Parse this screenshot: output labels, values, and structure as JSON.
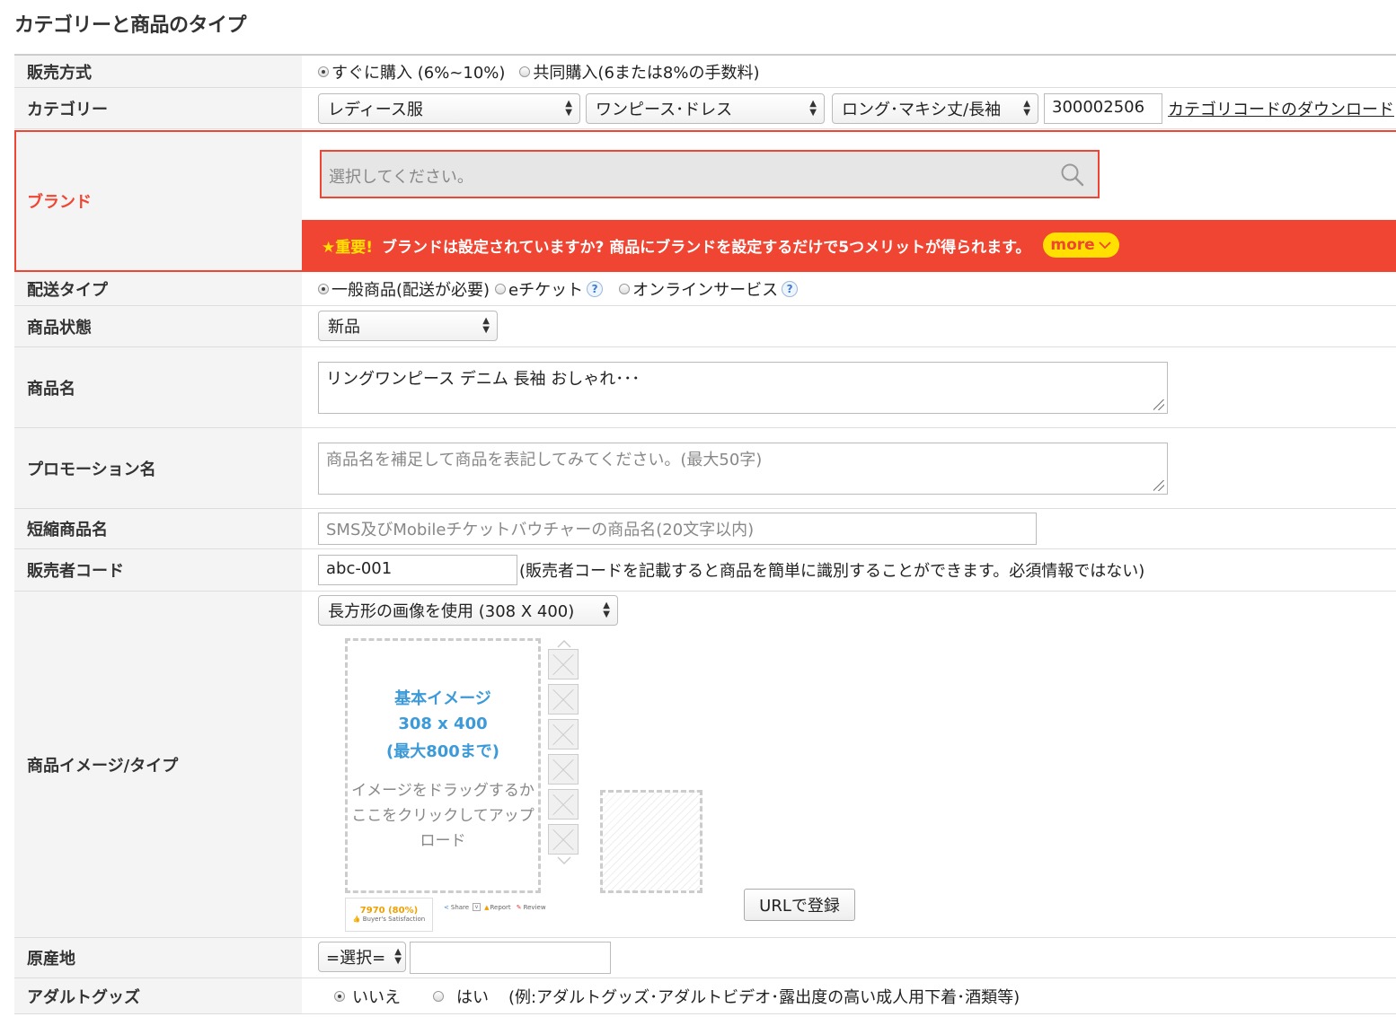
{
  "page_title": "カテゴリーと商品のタイプ",
  "sales_method": {
    "label": "販売方式",
    "options": [
      "すぐに購入 (6%~10%)",
      "共同購入(6または8%の手数料)"
    ]
  },
  "category": {
    "label": "カテゴリー",
    "level1": "レディース服",
    "level2": "ワンピース･ドレス",
    "level3": "ロング･マキシ丈/長袖",
    "code": "300002506",
    "download_link": "カテゴリコードのダウンロード"
  },
  "brand": {
    "label": "ブランド",
    "placeholder": "選択してください。",
    "notice_star": "★重要!",
    "notice_text": "ブランドは設定されていますか? 商品にブランドを設定するだけで5つメリットが得られます。",
    "more_label": "more",
    "accent_color": "#f04532",
    "more_color": "#ffe000"
  },
  "delivery_type": {
    "label": "配送タイプ",
    "options": [
      "一般商品(配送が必要)",
      "eチケット",
      "オンラインサービス"
    ],
    "help_glyph": "?"
  },
  "condition": {
    "label": "商品状態",
    "value": "新品"
  },
  "product_name": {
    "label": "商品名",
    "value": "リングワンピース デニム 長袖 おしゃれ･･･"
  },
  "promotion_name": {
    "label": "プロモーション名",
    "placeholder": "商品名を補足して商品を表記してみてください。(最大50字)"
  },
  "short_name": {
    "label": "短縮商品名",
    "placeholder": "SMS及びMobileチケットバウチャーの商品名(20文字以内)"
  },
  "seller_code": {
    "label": "販売者コード",
    "value": "abc-001",
    "note": "(販売者コードを記載すると商品を簡単に識別することができます。必須情報ではない)"
  },
  "product_image": {
    "label": "商品イメージ/タイプ",
    "image_type": "長方形の画像を使用 (308 X 400)",
    "main_title": "基本イメージ",
    "main_size": "308 x 400",
    "main_limit": "(最大800まで)",
    "upload_hint": "イメージをドラッグするかここをクリックしてアップロード",
    "satisfaction_value": "7970 (80%)",
    "satisfaction_label": "Buyer's Satisfaction",
    "share_label": "Share",
    "report_label": "Report",
    "review_label": "Review",
    "url_button": "URLで登録"
  },
  "origin": {
    "label": "原産地",
    "select_value": "=選択="
  },
  "adult_goods": {
    "label": "アダルトグッズ",
    "options": [
      "いいえ",
      "はい"
    ],
    "note": "(例:アダルトグッズ･アダルトビデオ･露出度の高い成人用下着･酒類等)"
  }
}
